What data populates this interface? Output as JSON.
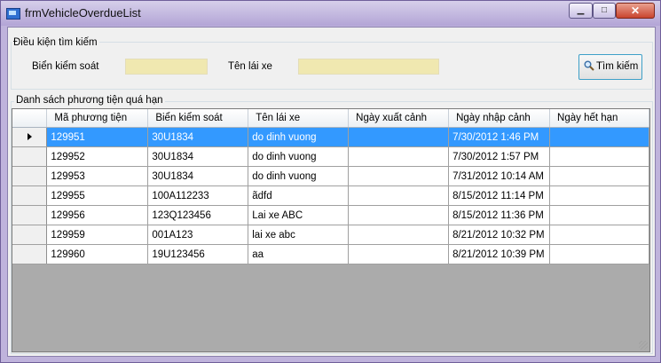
{
  "window": {
    "title": "frmVehicleOverdueList"
  },
  "search": {
    "group_title": "Điều kiện tìm kiếm",
    "plate_label": "Biển kiểm soát",
    "plate_value": "",
    "driver_label": "Tên lái xe",
    "driver_value": "",
    "button_label": "Tìm kiếm"
  },
  "list": {
    "group_title": "Danh sách phương tiện quá hạn",
    "columns": [
      "Mã phương tiện",
      "Biển kiểm soát",
      "Tên lái xe",
      "Ngày xuất cảnh",
      "Ngày nhập cảnh",
      "Ngày hết hạn"
    ],
    "selected_row": 0,
    "rows": [
      [
        "129951",
        "30U1834",
        "do dinh vuong",
        "",
        "7/30/2012 1:46 PM",
        ""
      ],
      [
        "129952",
        "30U1834",
        "do dinh vuong",
        "",
        "7/30/2012 1:57 PM",
        ""
      ],
      [
        "129953",
        "30U1834",
        "do dinh vuong",
        "",
        "7/31/2012 10:14 AM",
        ""
      ],
      [
        "129955",
        "100A112233",
        "ãdfd",
        "",
        "8/15/2012 11:14 PM",
        ""
      ],
      [
        "129956",
        "123Q123456",
        "Lai xe ABC",
        "",
        "8/15/2012 11:36 PM",
        ""
      ],
      [
        "129959",
        "001A123",
        "lai xe abc",
        "",
        "8/21/2012 10:32 PM",
        ""
      ],
      [
        "129960",
        "19U123456",
        "aa",
        "",
        "8/21/2012 10:39 PM",
        ""
      ]
    ]
  },
  "colors": {
    "selection": "#3399ff",
    "input_bg": "#f0e8b0",
    "grid_empty": "#ababab"
  },
  "icons": [
    "app-icon",
    "minimize-icon",
    "maximize-icon",
    "close-icon",
    "magnifier-icon",
    "row-pointer-icon"
  ]
}
